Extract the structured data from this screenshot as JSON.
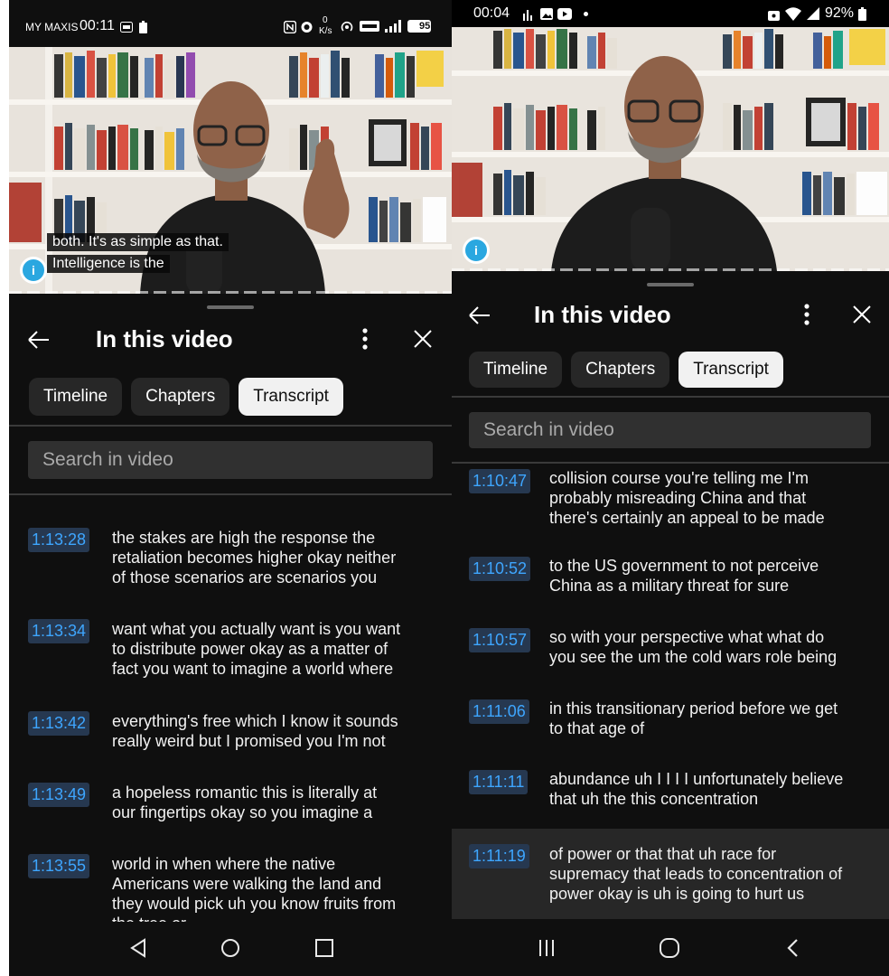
{
  "left": {
    "status": {
      "carrier": "MY MAXIS",
      "time": "00:11",
      "speed_value": "0",
      "speed_unit": "K/s",
      "battery": "95"
    },
    "video": {
      "caption_line1": "both. It's as simple as that.",
      "caption_line2": "Intelligence is the"
    },
    "sheet": {
      "title": "In this video",
      "tabs": [
        "Timeline",
        "Chapters",
        "Transcript"
      ],
      "active_tab": "Transcript",
      "search_placeholder": "Search in video"
    },
    "transcript": [
      {
        "time": "1:13:28",
        "text": [
          "the stakes are high the response the",
          "retaliation becomes higher okay neither",
          "of those scenarios are scenarios you"
        ]
      },
      {
        "time": "1:13:34",
        "text": [
          "want what you actually want is you want",
          "to distribute power okay as a matter of",
          "fact you want to imagine a world where"
        ]
      },
      {
        "time": "1:13:42",
        "text": [
          "everything's free which I know it sounds",
          "really weird but I promised you I'm not"
        ]
      },
      {
        "time": "1:13:49",
        "text": [
          "a hopeless romantic this is literally at",
          "our fingertips okay so you imagine a"
        ]
      },
      {
        "time": "1:13:55",
        "text": [
          "world in when where the native",
          "Americans were walking the land and",
          "they would pick uh you know fruits from",
          "the tree or"
        ]
      }
    ]
  },
  "right": {
    "status": {
      "time": "00:04",
      "battery": "92%"
    },
    "sheet": {
      "title": "In this video",
      "tabs": [
        "Timeline",
        "Chapters",
        "Transcript"
      ],
      "active_tab": "Transcript",
      "search_placeholder": "Search in video"
    },
    "transcript": [
      {
        "time": "1:10:47",
        "text": [
          "collision course you're telling me I'm",
          "probably misreading China and that",
          "there's certainly an appeal to be made"
        ]
      },
      {
        "time": "1:10:52",
        "text": [
          "to the US government to not perceive",
          "China as a military threat for sure"
        ]
      },
      {
        "time": "1:10:57",
        "text": [
          "so with your perspective what what do",
          "you see the um the cold wars role being"
        ]
      },
      {
        "time": "1:11:06",
        "text": [
          "in this transitionary period before we get",
          "to that age of"
        ]
      },
      {
        "time": "1:11:11",
        "text": [
          "abundance uh I I I I unfortunately believe",
          "that uh the this concentration"
        ]
      },
      {
        "time": "1:11:19",
        "text": [
          "of power or that that uh race for",
          "supremacy that leads to concentration of",
          "power okay is uh is going to hurt us"
        ]
      }
    ]
  },
  "colors": {
    "timestamp_text": "#3ea6ff",
    "timestamp_bg": "#263850",
    "active_tab_bg": "#f1f1f1",
    "sheet_bg": "#0f0f0f"
  },
  "icons": [
    "back-arrow-icon",
    "more-vert-icon",
    "close-icon",
    "nav-back-triangle-icon",
    "nav-home-circle-icon",
    "nav-recents-square-icon",
    "nav-recents-lines-icon",
    "nav-back-chevron-icon"
  ]
}
